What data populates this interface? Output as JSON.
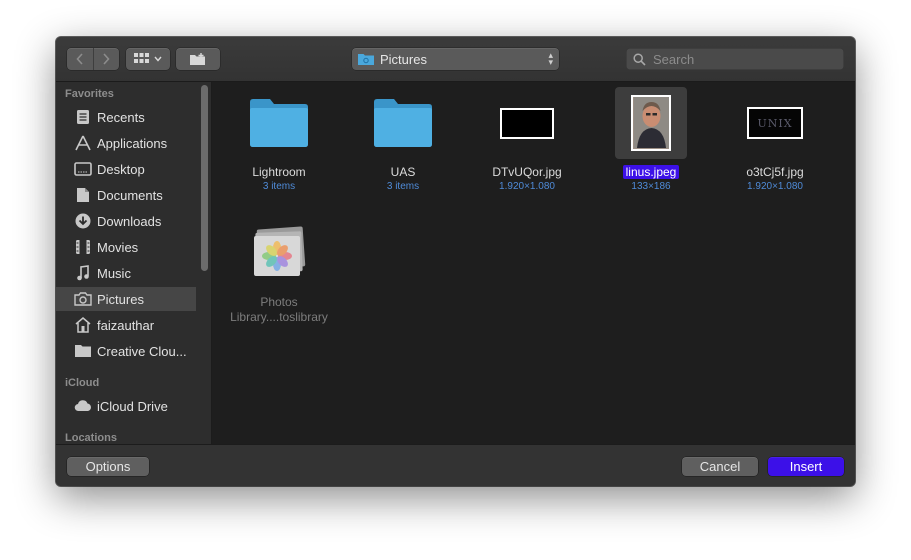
{
  "toolbar": {
    "path_label": "Pictures",
    "search_placeholder": "Search"
  },
  "sidebar": {
    "sections": [
      {
        "heading": "Favorites"
      },
      {
        "heading": "iCloud"
      },
      {
        "heading": "Locations"
      }
    ],
    "favorites": [
      {
        "label": "Recents",
        "icon": "recents-icon"
      },
      {
        "label": "Applications",
        "icon": "applications-icon"
      },
      {
        "label": "Desktop",
        "icon": "desktop-icon"
      },
      {
        "label": "Documents",
        "icon": "documents-icon"
      },
      {
        "label": "Downloads",
        "icon": "downloads-icon"
      },
      {
        "label": "Movies",
        "icon": "movies-icon"
      },
      {
        "label": "Music",
        "icon": "music-icon"
      },
      {
        "label": "Pictures",
        "icon": "camera-icon",
        "selected": true
      },
      {
        "label": "faizauthar",
        "icon": "home-icon"
      },
      {
        "label": "Creative Clou...",
        "icon": "folder-icon"
      }
    ],
    "icloud": [
      {
        "label": "iCloud Drive",
        "icon": "cloud-icon"
      }
    ]
  },
  "files": [
    {
      "name": "Lightroom",
      "meta": "3 items",
      "kind": "folder"
    },
    {
      "name": "UAS",
      "meta": "3 items",
      "kind": "folder"
    },
    {
      "name": "DTvUQor.jpg",
      "meta": "1.920×1.080",
      "kind": "image"
    },
    {
      "name": "linus.jpeg",
      "meta": "133×186",
      "kind": "image",
      "selected": true
    },
    {
      "name": "o3tCj5f.jpg",
      "meta": "1.920×1.080",
      "kind": "image",
      "thumb_text": "UNIX"
    },
    {
      "name_line1": "Photos",
      "name_line2": "Library....toslibrary",
      "kind": "photos-library",
      "dimmed": true
    }
  ],
  "buttons": {
    "options": "Options",
    "cancel": "Cancel",
    "insert": "Insert"
  },
  "colors": {
    "accent": "#3c10e8",
    "folder_blue": "#4aa8dc",
    "meta_blue": "#4f8bd8"
  }
}
